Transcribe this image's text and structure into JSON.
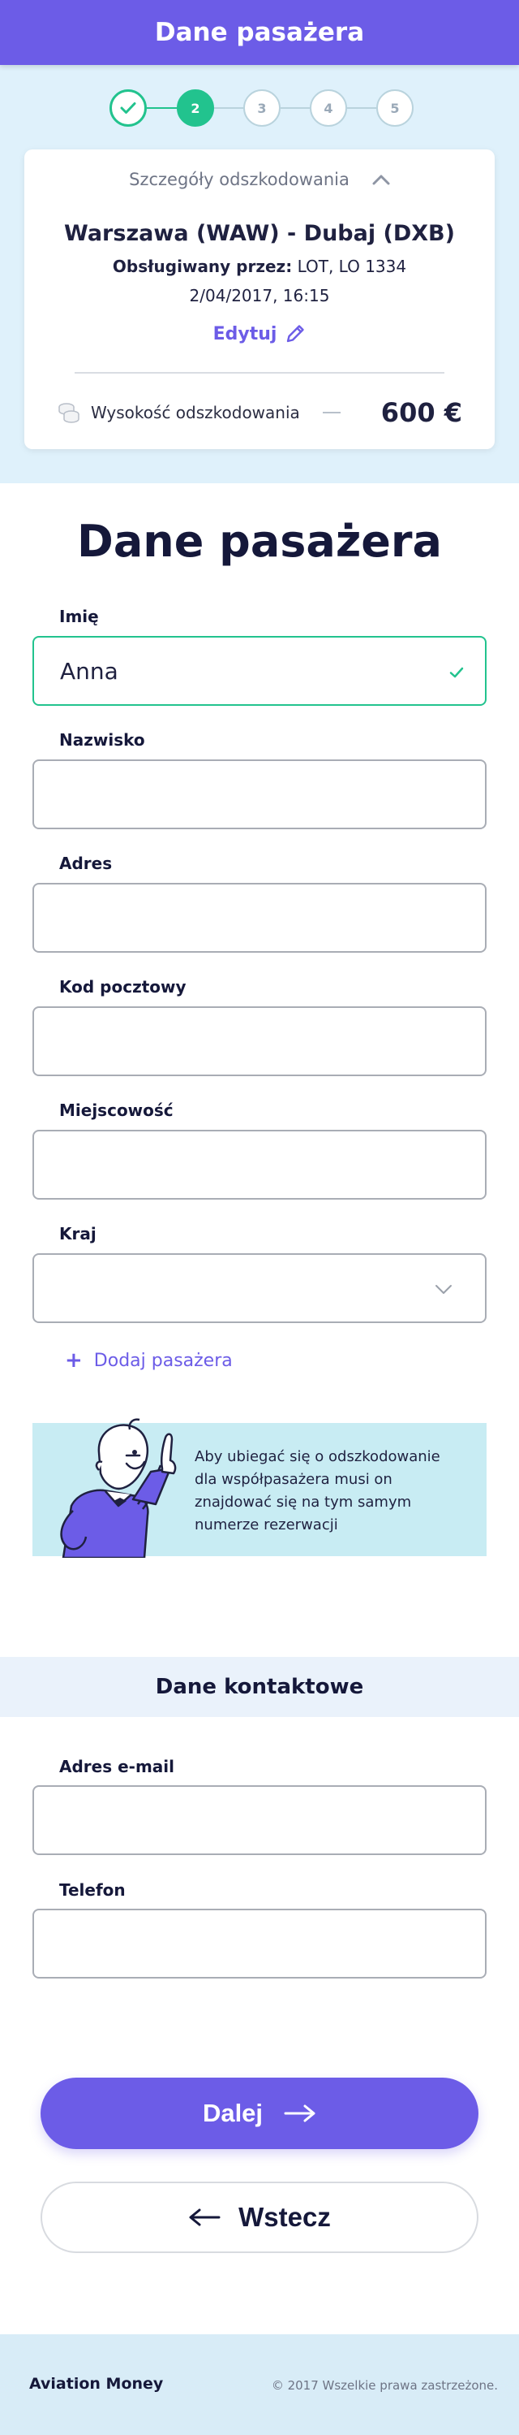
{
  "header": {
    "title": "Dane pasażera"
  },
  "stepper": {
    "steps": [
      {
        "label": "",
        "state": "done"
      },
      {
        "label": "2",
        "state": "current"
      },
      {
        "label": "3",
        "state": "upcoming"
      },
      {
        "label": "4",
        "state": "upcoming"
      },
      {
        "label": "5",
        "state": "upcoming"
      }
    ]
  },
  "summary": {
    "toggle_label": "Szczegóły odszkodowania",
    "route": "Warszawa (WAW) - Dubaj (DXB)",
    "operated_prefix": "Obsługiwany przez:",
    "operated_value": "LOT, LO 1334",
    "datetime": "2/04/2017, 16:15",
    "edit_label": "Edytuj",
    "compensation_label": "Wysokość odszkodowania",
    "compensation_amount": "600 €"
  },
  "form": {
    "title": "Dane pasażera",
    "fields": {
      "first_name": {
        "label": "Imię",
        "value": "Anna",
        "placeholder": ""
      },
      "last_name": {
        "label": "Nazwisko",
        "value": "",
        "placeholder": ""
      },
      "address": {
        "label": "Adres",
        "value": "",
        "placeholder": ""
      },
      "postal_code": {
        "label": "Kod pocztowy",
        "value": "",
        "placeholder": ""
      },
      "city": {
        "label": "Miejscowość",
        "value": "",
        "placeholder": ""
      },
      "country": {
        "label": "Kraj",
        "value": "",
        "placeholder": ""
      }
    },
    "add_passenger": "Dodaj pasażera",
    "info_text": "Aby ubiegać się o odszkodowanie dla współpasażera musi on znajdować się na tym samym numerze rezerwacji"
  },
  "contact": {
    "title": "Dane kontaktowe",
    "fields": {
      "email": {
        "label": "Adres e-mail",
        "value": "",
        "placeholder": ""
      },
      "phone": {
        "label": "Telefon",
        "value": "",
        "placeholder": ""
      }
    }
  },
  "buttons": {
    "next_label": "Dalej",
    "back_label": "Wstecz"
  },
  "footer": {
    "brand": "Aviation Money",
    "copyright": "© 2017 Wszelkie prawa zastrzeżone."
  },
  "colors": {
    "accent": "#6c5ce7",
    "success": "#22c38e",
    "hero_bg": "#dff1fb",
    "info_bg": "#c8ecf3"
  },
  "icons": {
    "step_done": "checkmark-icon",
    "toggle": "chevron-up-icon",
    "edit": "pencil-icon",
    "compensation": "coins-icon",
    "valid": "checkmark-icon",
    "select": "chevron-down-icon",
    "add": "plus-icon",
    "next": "arrow-right-icon",
    "back": "arrow-left-icon"
  }
}
